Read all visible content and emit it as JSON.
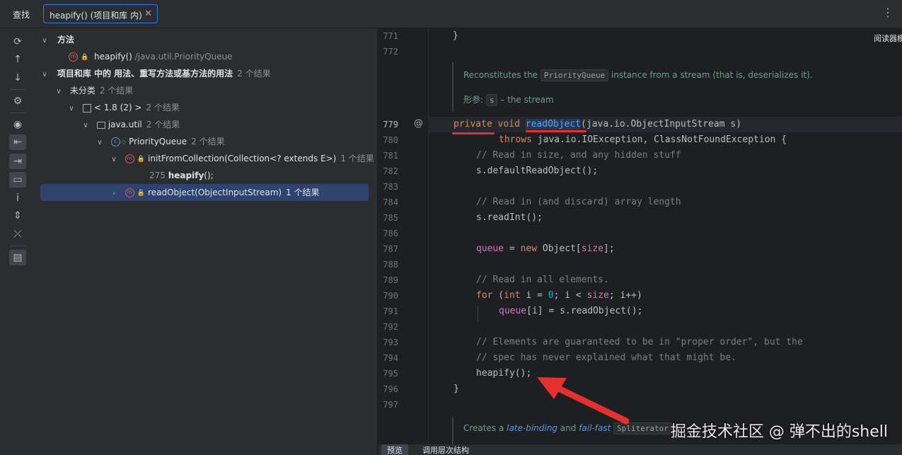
{
  "header": {
    "find_label": "查找",
    "tab_title": "heapify() (项目和库 内)",
    "tab_close": "✕",
    "menu": "⋮"
  },
  "toolbar_icons": [
    "rerun-icon",
    "arrow-up-icon",
    "arrow-down-icon",
    "settings-icon",
    "eye-icon",
    "import-icon",
    "export-icon",
    "folder-filter-icon",
    "info-icon",
    "expand-all-icon",
    "collapse-all-icon",
    "preview-icon"
  ],
  "tree": {
    "methods_header": "方法",
    "method_name": "heapify()",
    "method_path": " /java.util.PriorityQueue",
    "usages_header": "项目和库 中的 用法、重写方法或基方法的用法",
    "usages_count": "2 个结果",
    "uncategorized": "未分类",
    "uncategorized_count": "2 个结果",
    "jdk": "< 1.8 (2) >",
    "jdk_count": "2 个结果",
    "package": "java.util",
    "package_count": "2 个结果",
    "class": "PriorityQueue",
    "class_count": "2 个结果",
    "init_method": "initFromCollection(Collection<? extends E>)",
    "init_count": "1 个结果",
    "usage_line_no": "275",
    "usage_call": "heapify",
    "usage_rest": "();",
    "read_method": "readObject(ObjectInputStream)",
    "read_count": "1 个结果"
  },
  "editor": {
    "reader_mode": "阅读器模式",
    "doc1_pre": "Reconstitutes the ",
    "doc1_chip": "PriorityQueue",
    "doc1_post": " instance from a stream (that is, deserializes it).",
    "doc2_label": "形参: ",
    "doc2_chip": "s",
    "doc2_post": " – the stream",
    "doc3_pre": "Creates a ",
    "doc3_late": "late-binding",
    "doc3_and": " and ",
    "doc3_fail": "fail-fast",
    "doc3_chip": "Spliterator",
    "line_numbers": {
      "l771": "771",
      "l772": "772",
      "l779": "779",
      "l780": "780",
      "l781": "781",
      "l782": "782",
      "l783": "783",
      "l784": "784",
      "l785": "785",
      "l786": "786",
      "l787": "787",
      "l788": "788",
      "l789": "789",
      "l790": "790",
      "l791": "791",
      "l792": "792",
      "l793": "793",
      "l794": "794",
      "l795": "795",
      "l796": "796",
      "l797": "797"
    },
    "code": {
      "c771": "}",
      "c779_kw1": "private",
      "c779_kw2": "void",
      "c779_fn": "readObject",
      "c779_rest": "(java.io.ObjectInputStream s)",
      "c780_kw": "throws",
      "c780_rest": " java.io.IOException, ClassNotFoundException {",
      "c781": "// Read in size, and any hidden stuff",
      "c782": "s.defaultReadObject();",
      "c784": "// Read in (and discard) array length",
      "c785": "s.readInt();",
      "c787_fld": "queue",
      "c787_eq": " = ",
      "c787_kw": "new",
      "c787_mid": " Object[",
      "c787_fld2": "size",
      "c787_end": "];",
      "c789": "// Read in all elements.",
      "c790_kw": "for",
      "c790_a": " (",
      "c790_kw2": "int",
      "c790_b": " i = ",
      "c790_num": "0",
      "c790_c": "; i < ",
      "c790_fld": "size",
      "c790_d": "; i++)",
      "c791_fld": "queue",
      "c791_rest": "[i] = s.readObject();",
      "c793": "// Elements are guaranteed to be in \"proper order\", but the",
      "c794": "// spec has never explained what that might be.",
      "c795": "heapify();",
      "c796": "}"
    }
  },
  "bottom_tabs": {
    "preview": "预览",
    "hierarchy": "调用层次结构"
  },
  "watermark": "掘金技术社区 @ 弹不出的shell",
  "colors": {
    "accent": "#3574f0",
    "selection": "#2e436e",
    "annotation_red": "#e53030"
  }
}
